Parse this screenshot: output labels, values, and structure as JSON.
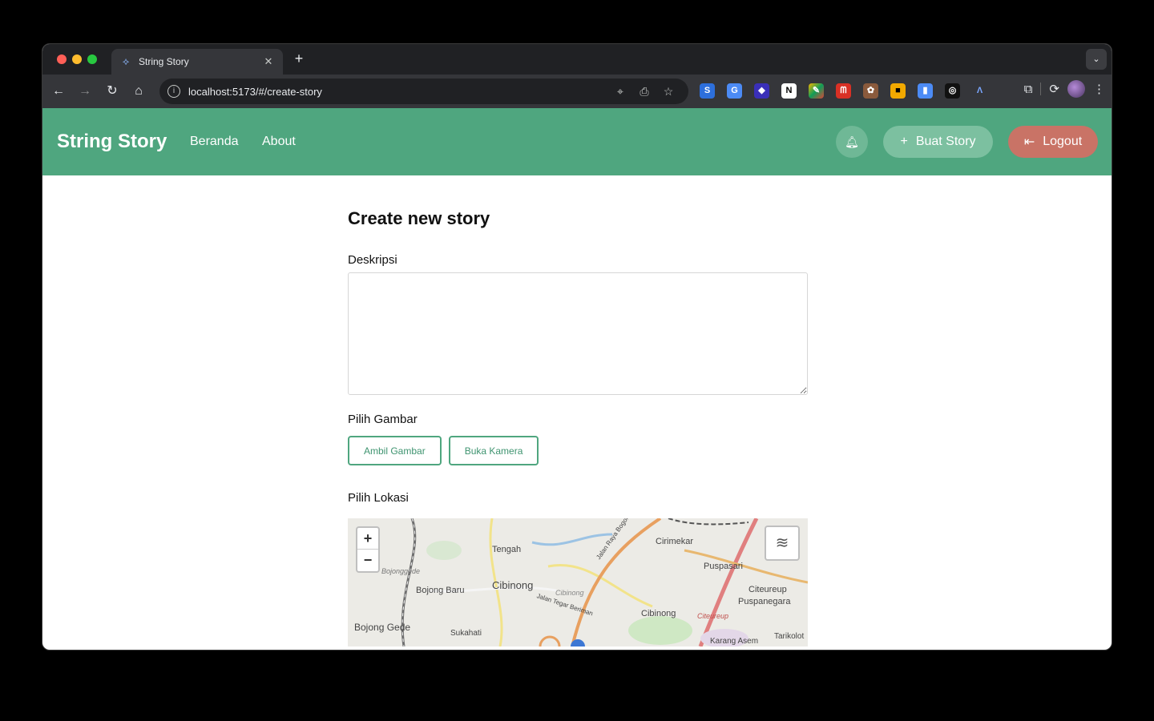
{
  "browser": {
    "tab_title": "String Story",
    "url": "localhost:5173/#/create-story",
    "extensions": [
      "S",
      "G",
      "◆",
      "N",
      "✎",
      "ᗰ",
      "✿",
      "■",
      "▮",
      "◎",
      "Λ"
    ]
  },
  "header": {
    "brand": "String Story",
    "nav": [
      "Beranda",
      "About"
    ],
    "create_button": "Buat Story",
    "logout_button": "Logout"
  },
  "form": {
    "title": "Create new story",
    "description_label": "Deskripsi",
    "image_label": "Pilih Gambar",
    "take_image_button": "Ambil Gambar",
    "open_camera_button": "Buka Kamera",
    "location_label": "Pilih Lokasi"
  },
  "map": {
    "zoom_in": "+",
    "zoom_out": "−",
    "places": [
      "Tengah",
      "Cirimekar",
      "Puspasari",
      "Bojonggede",
      "Bojong Baru",
      "Cibinong",
      "Cibinong",
      "Citeureup",
      "Puspanegara",
      "Cibinong",
      "Citeureup",
      "Bojong Gede",
      "Sukahati",
      "Tarikolot",
      "Karang Asem",
      "Jalan Raya Bogor",
      "Jalan Tegar Beriman"
    ]
  },
  "colors": {
    "primary": "#4fa67f",
    "logout": "#c97366"
  }
}
